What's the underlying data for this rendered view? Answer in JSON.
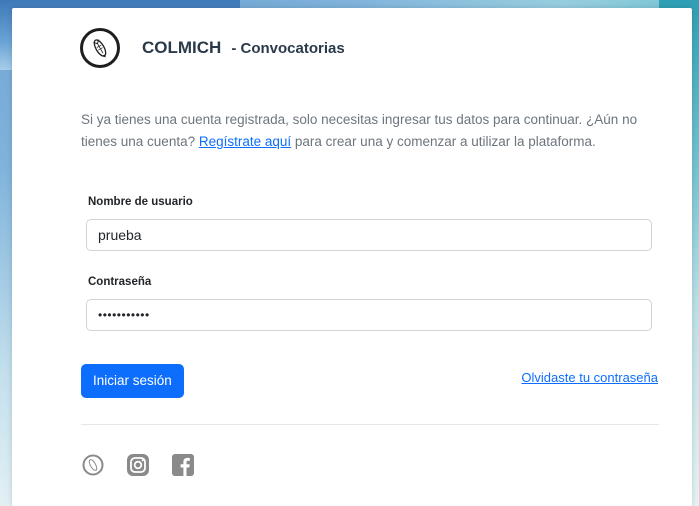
{
  "header": {
    "brand": "COLMICH",
    "subtitle": "- Convocatorias",
    "logo_icon": "fish-logo-icon"
  },
  "intro": {
    "before_link": "Si ya tienes una cuenta registrada, solo necesitas ingresar tus datos para continuar. ¿Aún no tienes una cuenta? ",
    "link": "Regístrate aquí",
    "after_link": " para crear una y comenzar a utilizar la plataforma."
  },
  "form": {
    "username_label": "Nombre de usuario",
    "username_value": "prueba",
    "password_label": "Contraseña",
    "password_value": "•••••••••••"
  },
  "actions": {
    "login_label": "Iniciar sesión",
    "forgot_label": "Olvidaste tu contraseña"
  },
  "social": [
    "fish-logo-icon",
    "instagram-icon",
    "facebook-icon"
  ],
  "colors": {
    "primary": "#0d6efd",
    "muted_text": "#6c757d",
    "brand_text": "#2b3a4a"
  }
}
